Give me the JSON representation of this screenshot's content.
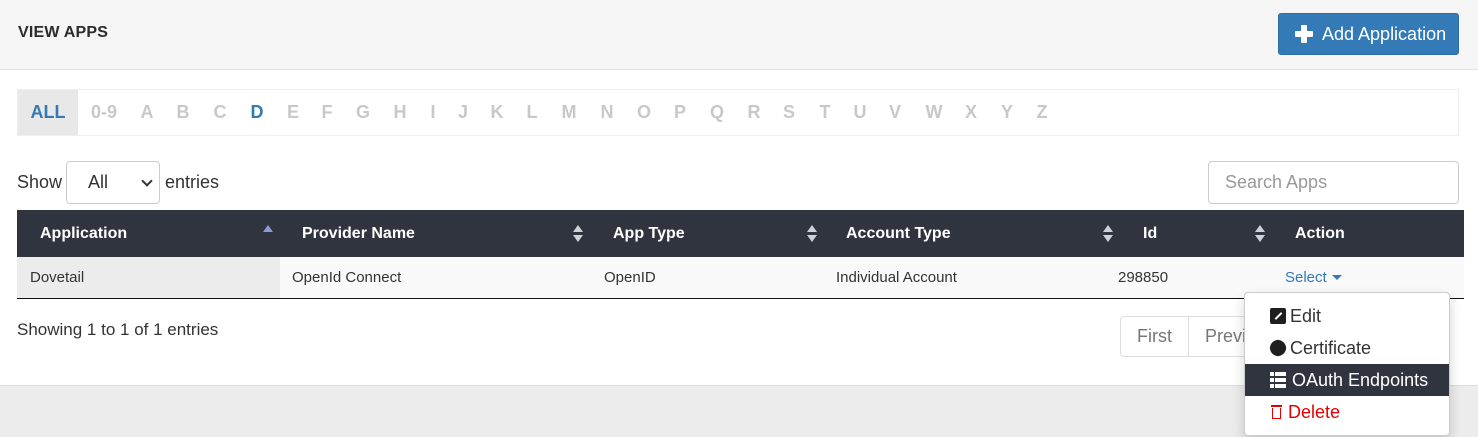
{
  "header": {
    "title": "VIEW APPS",
    "add_button_label": "Add Application",
    "accent_color": "#337ab7"
  },
  "alphabet": {
    "items": [
      "ALL",
      "0-9",
      "A",
      "B",
      "C",
      "D",
      "E",
      "F",
      "G",
      "H",
      "I",
      "J",
      "K",
      "L",
      "M",
      "N",
      "O",
      "P",
      "Q",
      "R",
      "S",
      "T",
      "U",
      "V",
      "W",
      "X",
      "Y",
      "Z"
    ],
    "selected": "ALL",
    "highlighted": "D"
  },
  "controls": {
    "show_label": "Show",
    "entries_selected": "All",
    "entries_label": "entries",
    "search_placeholder": "Search Apps"
  },
  "table": {
    "header_color": "#2f343f",
    "columns": [
      "Application",
      "Provider Name",
      "App Type",
      "Account Type",
      "Id",
      "Action"
    ],
    "sorted_column": "Application",
    "sort_direction": "ascending",
    "rows": [
      {
        "application": "Dovetail",
        "provider_name": "OpenId Connect",
        "app_type": "OpenID",
        "account_type": "Individual Account",
        "id": "298850",
        "action": "Select"
      }
    ]
  },
  "footer": {
    "info": "Showing 1 to 1 of 1 entries",
    "pagination": [
      "First",
      "Previ"
    ]
  },
  "action_menu": {
    "items": [
      {
        "label": "Edit",
        "icon": "edit-icon"
      },
      {
        "label": "Certificate",
        "icon": "certificate-icon"
      },
      {
        "label": "OAuth Endpoints",
        "icon": "table-icon"
      },
      {
        "label": "Delete",
        "icon": "trash-icon"
      }
    ],
    "highlighted": "OAuth Endpoints",
    "danger_color": "#e00000"
  }
}
